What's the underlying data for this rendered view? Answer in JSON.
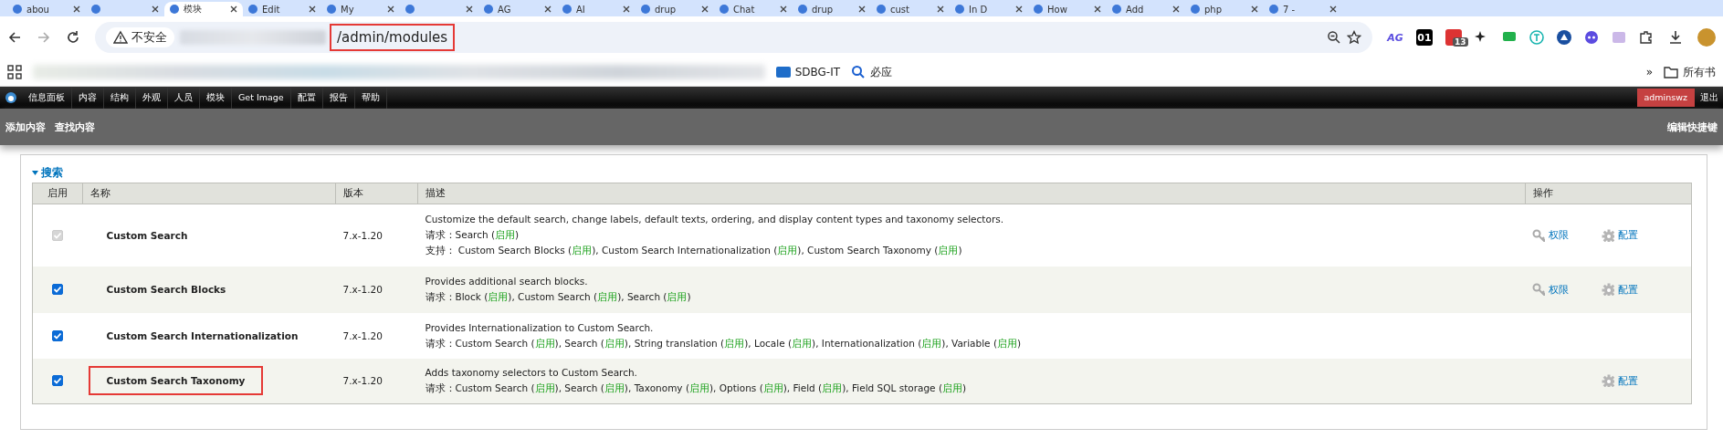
{
  "browser": {
    "tabs": [
      {
        "title": "abou",
        "selected": false
      },
      {
        "selected": false
      },
      {
        "title": "模块",
        "selected": true
      },
      {
        "title": "Edit",
        "selected": false
      },
      {
        "title": "My",
        "selected": false
      },
      {
        "selected": false
      },
      {
        "title": "AG",
        "selected": false
      },
      {
        "title": "AI",
        "selected": false
      },
      {
        "title": "drup",
        "selected": false
      },
      {
        "title": "Chat",
        "selected": false
      },
      {
        "title": "drup",
        "selected": false
      },
      {
        "title": "cust",
        "selected": false
      },
      {
        "title": "In D",
        "selected": false
      },
      {
        "title": "How",
        "selected": false
      },
      {
        "title": "Add",
        "selected": false
      },
      {
        "title": "php",
        "selected": false
      },
      {
        "title": "7 -",
        "selected": false
      }
    ],
    "address": {
      "security": "不安全",
      "path": "/admin/modules",
      "highlighted": true
    },
    "extensions": [
      {
        "kind": "ag",
        "label": "AG"
      },
      {
        "kind": "box",
        "label": "01"
      },
      {
        "kind": "badge",
        "label": "13"
      },
      {
        "kind": "sparkle"
      },
      {
        "kind": "chat"
      },
      {
        "kind": "t"
      },
      {
        "kind": "tri"
      },
      {
        "kind": "face"
      },
      {
        "kind": "mail"
      },
      {
        "kind": "puzzle"
      }
    ],
    "bookmarks": [
      {
        "label": "SDBG-IT"
      },
      {
        "label": "必应"
      }
    ],
    "bookmarks_overflow": "»",
    "all_bookmarks": "所有书"
  },
  "admin_menu": {
    "items": [
      "信息面板",
      "内容",
      "结构",
      "外观",
      "人员",
      "模块",
      "Get Image",
      "配置",
      "报告",
      "帮助"
    ],
    "user": "adminswz",
    "logout": "退出"
  },
  "shortcuts": {
    "items": [
      "添加内容",
      "查找内容"
    ],
    "edit": "编辑快捷键"
  },
  "fieldset": {
    "legend": "搜索",
    "expanded": true
  },
  "table": {
    "columns": [
      "启用",
      "名称",
      "版本",
      "描述",
      "操作"
    ],
    "rows": [
      {
        "checked": true,
        "disabled": true,
        "highlighted": false,
        "name": "Custom Search",
        "version": "7.x-1.20",
        "description": "Customize the default search, change labels, default texts, ordering, and display content types and taxonomy selectors.",
        "dependency_lines": [
          [
            {
              "kind": "text",
              "text": "请求：Search ("
            },
            {
              "kind": "status",
              "text": "启用"
            },
            {
              "kind": "text",
              "text": ")"
            }
          ],
          [
            {
              "kind": "text",
              "text": "支持： Custom Search Blocks ("
            },
            {
              "kind": "status",
              "text": "启用"
            },
            {
              "kind": "text",
              "text": "), Custom Search Internationalization ("
            },
            {
              "kind": "status",
              "text": "启用"
            },
            {
              "kind": "text",
              "text": "), Custom Search Taxonomy ("
            },
            {
              "kind": "status",
              "text": "启用"
            },
            {
              "kind": "text",
              "text": ")"
            }
          ]
        ],
        "operations": [
          {
            "kind": "permissions",
            "label": "权限"
          },
          {
            "kind": "configure",
            "label": "配置"
          }
        ]
      },
      {
        "checked": true,
        "disabled": false,
        "highlighted": false,
        "name": "Custom Search Blocks",
        "version": "7.x-1.20",
        "description": "Provides additional search blocks.",
        "dependency_lines": [
          [
            {
              "kind": "text",
              "text": "请求：Block ("
            },
            {
              "kind": "status",
              "text": "启用"
            },
            {
              "kind": "text",
              "text": "), Custom Search ("
            },
            {
              "kind": "status",
              "text": "启用"
            },
            {
              "kind": "text",
              "text": "), Search ("
            },
            {
              "kind": "status",
              "text": "启用"
            },
            {
              "kind": "text",
              "text": ")"
            }
          ]
        ],
        "operations": [
          {
            "kind": "permissions",
            "label": "权限"
          },
          {
            "kind": "configure",
            "label": "配置"
          }
        ]
      },
      {
        "checked": true,
        "disabled": false,
        "highlighted": false,
        "name": "Custom Search Internationalization",
        "version": "7.x-1.20",
        "description": "Provides Internationalization to Custom Search.",
        "dependency_lines": [
          [
            {
              "kind": "text",
              "text": "请求：Custom Search ("
            },
            {
              "kind": "status",
              "text": "启用"
            },
            {
              "kind": "text",
              "text": "), Search ("
            },
            {
              "kind": "status",
              "text": "启用"
            },
            {
              "kind": "text",
              "text": "), String translation ("
            },
            {
              "kind": "status",
              "text": "启用"
            },
            {
              "kind": "text",
              "text": "), Locale ("
            },
            {
              "kind": "status",
              "text": "启用"
            },
            {
              "kind": "text",
              "text": "), Internationalization ("
            },
            {
              "kind": "status",
              "text": "启用"
            },
            {
              "kind": "text",
              "text": "), Variable ("
            },
            {
              "kind": "status",
              "text": "启用"
            },
            {
              "kind": "text",
              "text": ")"
            }
          ]
        ],
        "operations": []
      },
      {
        "checked": true,
        "disabled": false,
        "highlighted": true,
        "name": "Custom Search Taxonomy",
        "version": "7.x-1.20",
        "description": "Adds taxonomy selectors to Custom Search.",
        "dependency_lines": [
          [
            {
              "kind": "text",
              "text": "请求：Custom Search ("
            },
            {
              "kind": "status",
              "text": "启用"
            },
            {
              "kind": "text",
              "text": "), Search ("
            },
            {
              "kind": "status",
              "text": "启用"
            },
            {
              "kind": "text",
              "text": "), Taxonomy ("
            },
            {
              "kind": "status",
              "text": "启用"
            },
            {
              "kind": "text",
              "text": "), Options ("
            },
            {
              "kind": "status",
              "text": "启用"
            },
            {
              "kind": "text",
              "text": "), Field ("
            },
            {
              "kind": "status",
              "text": "启用"
            },
            {
              "kind": "text",
              "text": "), Field SQL storage ("
            },
            {
              "kind": "status",
              "text": "启用"
            },
            {
              "kind": "text",
              "text": ")"
            }
          ]
        ],
        "operations": [
          {
            "kind": "configure",
            "label": "配置"
          }
        ]
      }
    ]
  }
}
